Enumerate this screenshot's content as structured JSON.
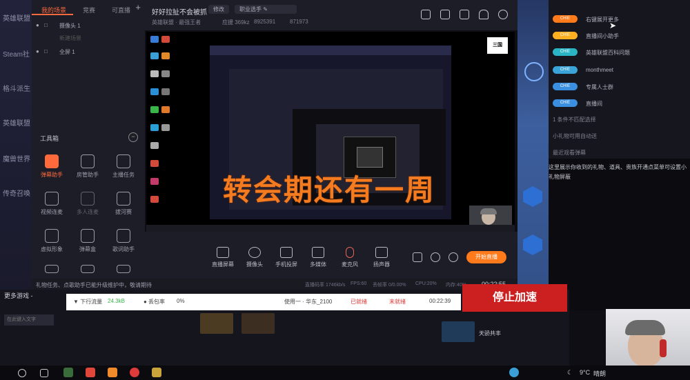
{
  "game_sidebar": {
    "items": [
      "英雄联盟",
      "Steam社",
      "格斗派生",
      "英雄联盟",
      "魔兽世界",
      "传奇召唤"
    ],
    "more_games": "更多游戏 -"
  },
  "obs_panel": {
    "tabs": [
      "我的场景",
      "竞赛",
      "可直播"
    ],
    "add_label": "+",
    "layers": [
      "摄像头 1",
      "新建场景",
      "全屏 1"
    ],
    "toolbox_title": "工具箱",
    "tools": [
      {
        "label": "弹幕助手",
        "active": true
      },
      {
        "label": "房管助手",
        "active": false
      },
      {
        "label": "主播任务",
        "active": false
      },
      {
        "label": "视频连麦",
        "active": false
      },
      {
        "label": "多人连麦",
        "active": false
      },
      {
        "label": "拔河赛",
        "active": false
      },
      {
        "label": "虚拟形象",
        "active": false
      },
      {
        "label": "弹幕盒",
        "active": false
      },
      {
        "label": "歌词助手",
        "active": false
      }
    ]
  },
  "room": {
    "title": "好好拉扯不会被抓",
    "edit_label": "修改",
    "category": "职业选手",
    "tags": "英雄联盟 · 最强王者",
    "stats": [
      "应援 369kz",
      "8925391",
      "871973"
    ]
  },
  "preview": {
    "subtitle": "转会期还有一周",
    "logo": "三国"
  },
  "controls": {
    "buttons": [
      "直播屏幕",
      "摄像头",
      "手机投屏",
      "多媒体",
      "麦克风",
      "扬声器"
    ],
    "live_button": "开始直播"
  },
  "status_bar": {
    "notice": "礼物任务、点歌助手已能升级维护中，敬请期待",
    "stats": [
      "直播码率 1746kb/s",
      "FPS:60",
      "丢帧率 0/0.00%",
      "CPU:20%",
      "内存:40%"
    ],
    "time": "00:22:55"
  },
  "right_panel": {
    "items": [
      {
        "tag": "CHIE",
        "label": "右键展开更多",
        "color": "#ff7a1a"
      },
      {
        "tag": "CHIE",
        "label": "直播间小助手",
        "color": "#ffb020"
      },
      {
        "tag": "CHIE",
        "label": "英雄联盟百科问题",
        "color": "#2bb5c4"
      },
      {
        "tag": "CHIE",
        "label": "monthmeet",
        "color": "#3aa3d8"
      },
      {
        "tag": "CHIE",
        "label": "专属人士群",
        "color": "#3a8fe0"
      },
      {
        "tag": "CHIE",
        "label": "直播间",
        "color": "#3a8fe0"
      }
    ],
    "lines": [
      "1 条件不匹配选择",
      "小礼物可用自动送",
      "最近观看弹幕"
    ],
    "note": "这里展示你收到的礼物、道具、贵族开通点菜单可设置小礼物屏蔽"
  },
  "booster": {
    "download_label": "▼ 下行流量",
    "download_value": "24.3kB",
    "loss_label": "● 丢包率",
    "loss_value": "0%",
    "server": "使用一 · 华东_2100",
    "status_a": "已就绪",
    "status_b": "未就绪",
    "timer": "00:22:39",
    "stop_button": "停止加速",
    "search_placeholder": "在此键入文字",
    "sky_label": "天骄共丰"
  },
  "taskbar": {
    "weather": "9°C",
    "weather_text": "晴朗"
  }
}
